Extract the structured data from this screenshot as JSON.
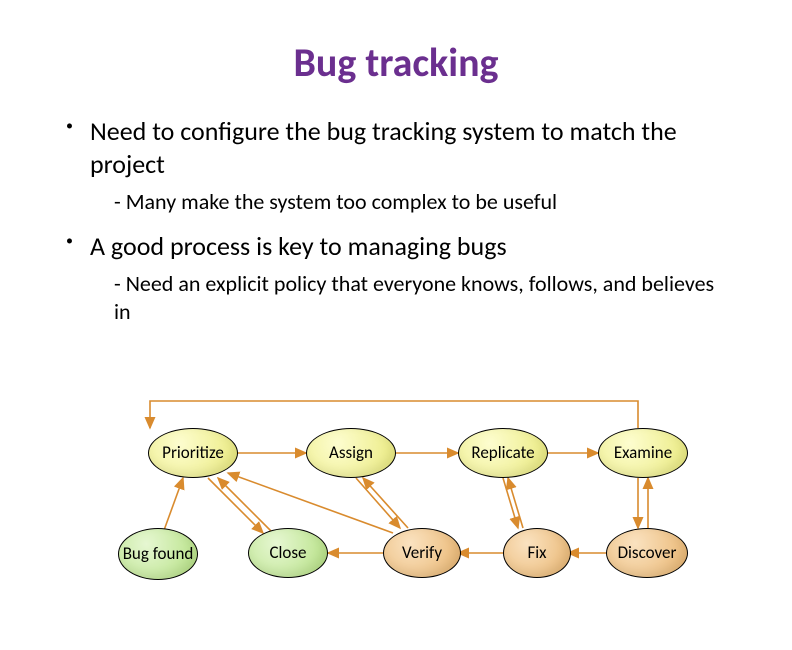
{
  "title": "Bug tracking",
  "bullets": {
    "b1": "Need to configure the bug tracking system to match the project",
    "b1_sub": "- Many make the system too complex to be useful",
    "b2": "A good process is key to managing bugs",
    "b2_sub": "- Need an explicit policy that everyone knows, follows, and believes in"
  },
  "diagram": {
    "nodes": {
      "prioritize": "Prioritize",
      "assign": "Assign",
      "replicate": "Replicate",
      "examine": "Examine",
      "bug_found": "Bug\nfound",
      "close": "Close",
      "verify": "Verify",
      "fix": "Fix",
      "discover": "Discover"
    }
  }
}
